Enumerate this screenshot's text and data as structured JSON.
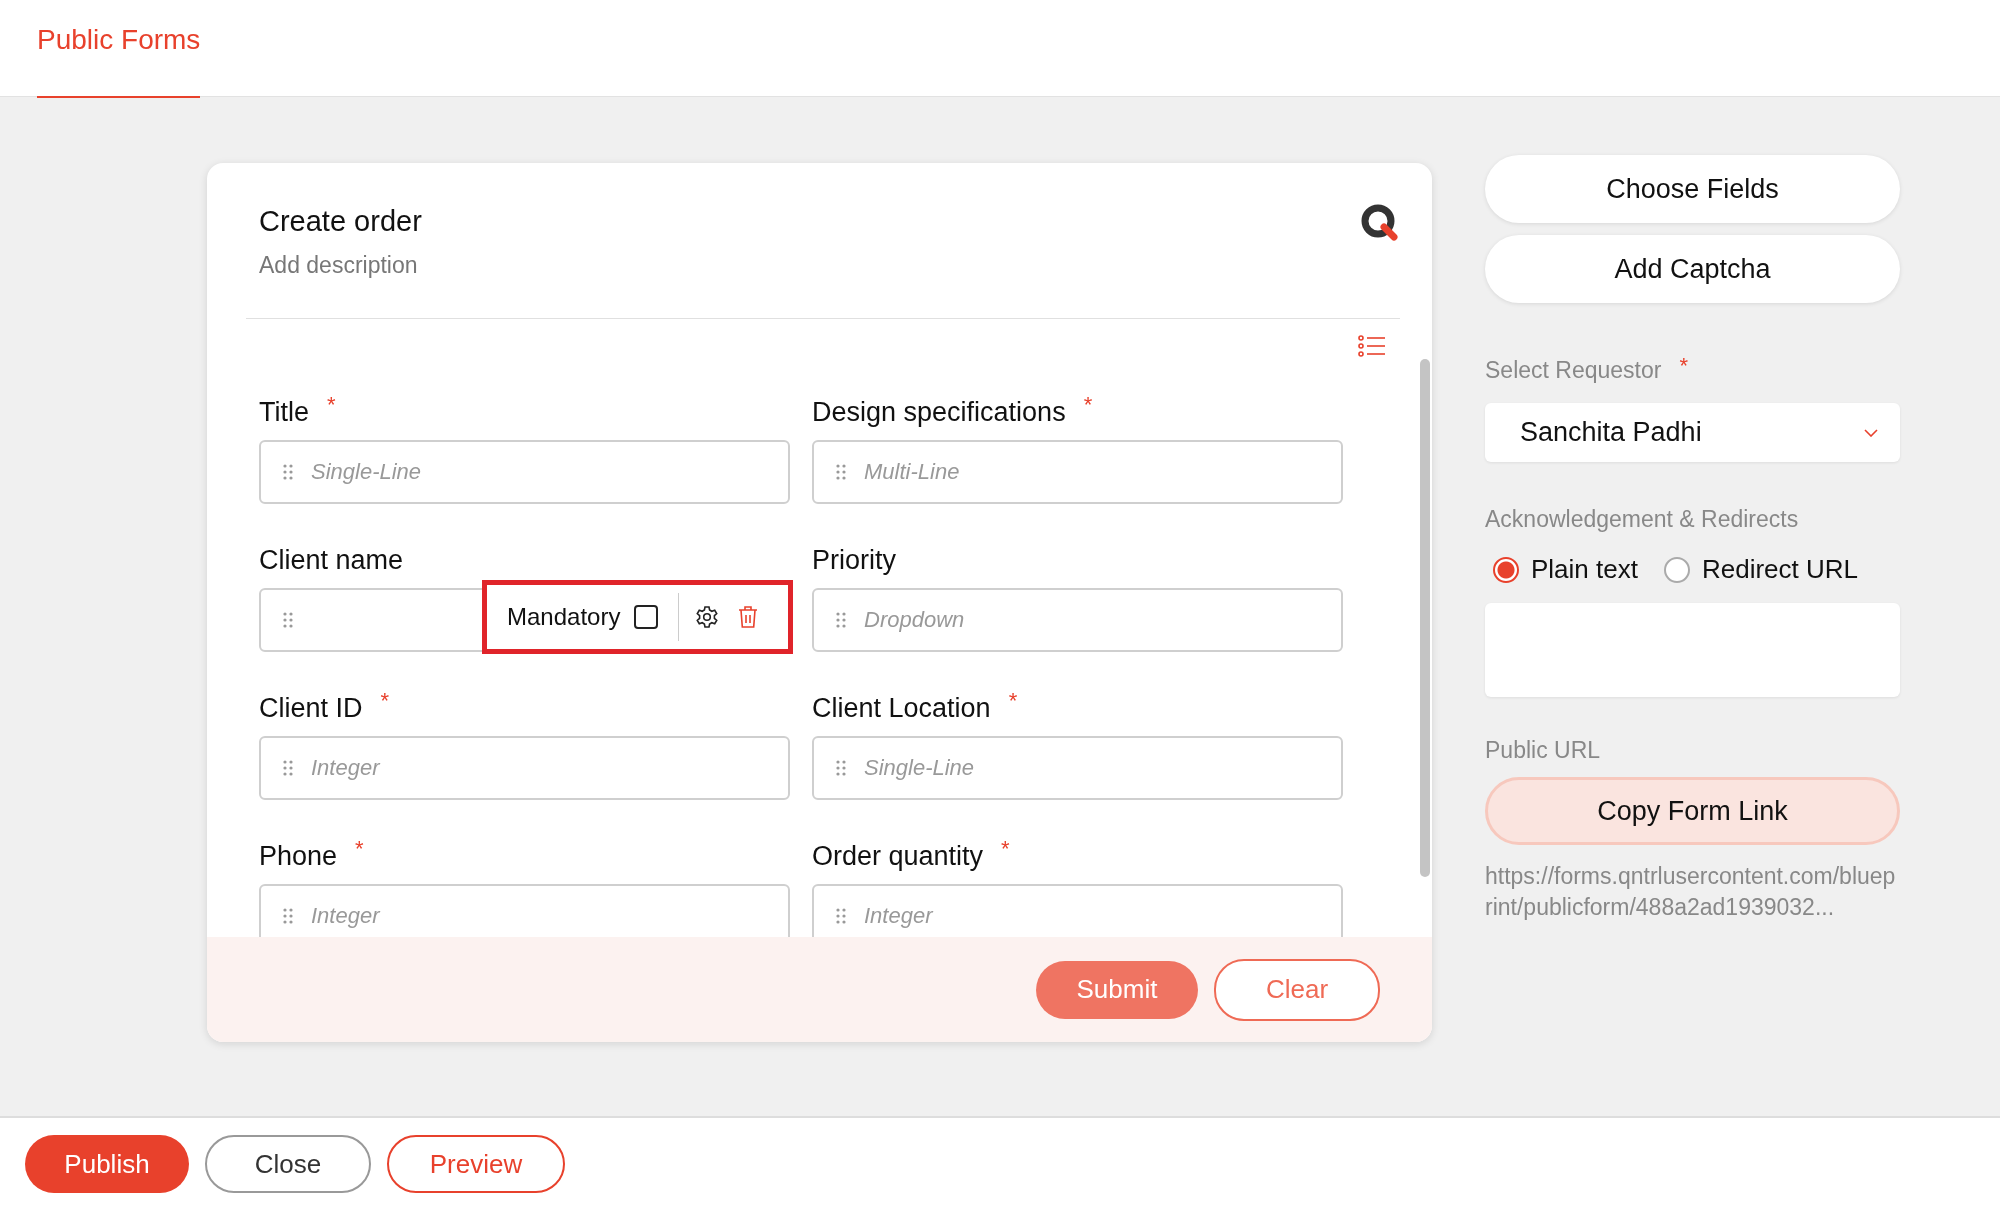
{
  "tab": {
    "label": "Public Forms",
    "selected": true
  },
  "form": {
    "title": "Create order",
    "description": "Add description",
    "fields": [
      {
        "label": "Title",
        "required_mark": "*",
        "placeholder": "Single-Line"
      },
      {
        "label": "Design specifications",
        "required_mark": "*",
        "placeholder": "Multi-Line"
      },
      {
        "label": "Client name",
        "toolbar": {
          "label": "Mandatory",
          "checked": false
        }
      },
      {
        "label": "Priority",
        "placeholder": "Dropdown"
      },
      {
        "label": "Client ID",
        "required_mark": "*",
        "placeholder": "Integer"
      },
      {
        "label": "Client Location",
        "required_mark": "*",
        "placeholder": "Single-Line"
      },
      {
        "label": "Phone",
        "required_mark": "*",
        "placeholder": "Integer"
      },
      {
        "label": "Order quantity",
        "required_mark": "*",
        "placeholder": "Integer"
      }
    ],
    "actions": [
      {
        "label": "Submit",
        "kind": "primary"
      },
      {
        "label": "Clear",
        "kind": "outline"
      }
    ]
  },
  "sidebar": {
    "buttons": [
      "Choose Fields",
      "Add Captcha"
    ],
    "requestor": {
      "label": "Select Requestor",
      "required_mark": "*",
      "value": "Sanchita Padhi"
    },
    "acknowledgement": {
      "label": "Acknowledgement & Redirects",
      "options": [
        {
          "label": "Plain text",
          "selected": true
        },
        {
          "label": "Redirect URL",
          "selected": false
        }
      ]
    },
    "public_url": {
      "label": "Public URL",
      "button": "Copy Form Link",
      "url": "https://forms.qntrlusercontent.com/blueprint/publicform/488a2ad1939032..."
    }
  },
  "footer_buttons": [
    {
      "label": "Publish",
      "kind": "primary"
    },
    {
      "label": "Close",
      "kind": "secondary"
    },
    {
      "label": "Preview",
      "kind": "outline"
    }
  ]
}
